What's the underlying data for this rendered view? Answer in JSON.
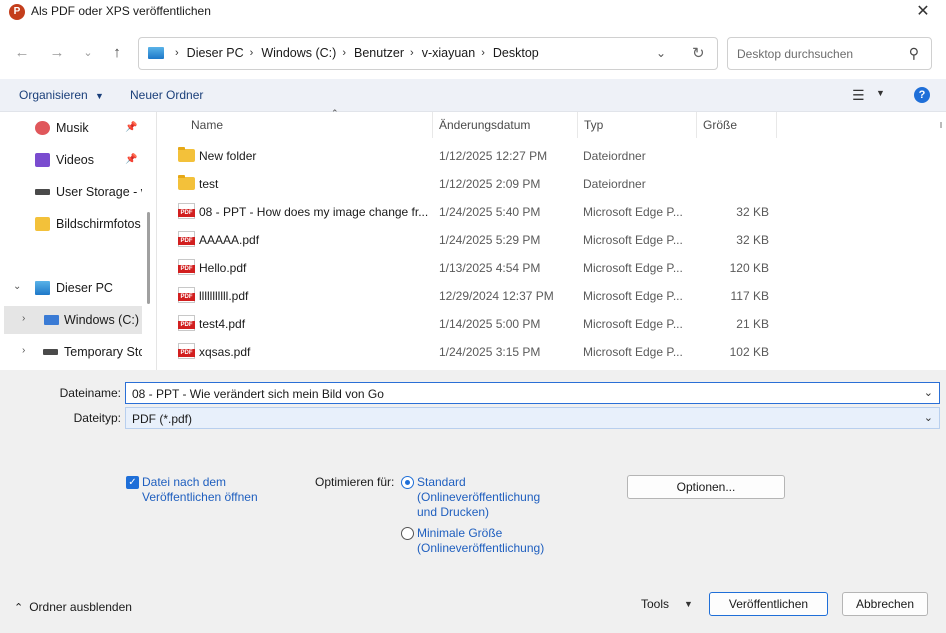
{
  "window": {
    "title": "Als PDF oder XPS veröffentlichen",
    "app_icon_letter": "P"
  },
  "address": {
    "crumbs": [
      "Dieser PC",
      "Windows (C:)",
      "Benutzer",
      "v-xiayuan",
      "Desktop"
    ],
    "search_placeholder": "Desktop durchsuchen"
  },
  "toolbar": {
    "organize": "Organisieren",
    "new_folder": "Neuer Ordner"
  },
  "nav": {
    "items": [
      {
        "label": "Musik",
        "icon": "music-icon",
        "pinned": true
      },
      {
        "label": "Videos",
        "icon": "video-icon",
        "pinned": true
      },
      {
        "label": "User Storage - v",
        "icon": "drive-icon",
        "pinned": false
      },
      {
        "label": "Bildschirmfotos",
        "icon": "folder-icon",
        "pinned": false
      },
      {
        "label": "Dieser PC",
        "icon": "pc-icon",
        "pinned": false
      },
      {
        "label": "Windows (C:)",
        "icon": "windows-drive-icon",
        "pinned": false
      },
      {
        "label": "Temporary Sto",
        "icon": "drive-icon",
        "pinned": false
      }
    ]
  },
  "files": {
    "columns": [
      "Name",
      "Änderungsdatum",
      "Typ",
      "Größe"
    ],
    "rows": [
      {
        "name": "New folder",
        "date": "1/12/2025 12:27 PM",
        "type": "Dateiordner",
        "size": "",
        "kind": "folder"
      },
      {
        "name": "test",
        "date": "1/12/2025 2:09 PM",
        "type": "Dateiordner",
        "size": "",
        "kind": "folder"
      },
      {
        "name": "08 - PPT - How does my image change fr...",
        "date": "1/24/2025 5:40 PM",
        "type": "Microsoft Edge P...",
        "size": "32 KB",
        "kind": "pdf"
      },
      {
        "name": "AAAAA.pdf",
        "date": "1/24/2025 5:29 PM",
        "type": "Microsoft Edge P...",
        "size": "32 KB",
        "kind": "pdf"
      },
      {
        "name": "Hello.pdf",
        "date": "1/13/2025 4:54 PM",
        "type": "Microsoft Edge P...",
        "size": "120 KB",
        "kind": "pdf"
      },
      {
        "name": "lllllllllll.pdf",
        "date": "12/29/2024 12:37 PM",
        "type": "Microsoft Edge P...",
        "size": "117 KB",
        "kind": "pdf"
      },
      {
        "name": "test4.pdf",
        "date": "1/14/2025 5:00 PM",
        "type": "Microsoft Edge P...",
        "size": "21 KB",
        "kind": "pdf"
      },
      {
        "name": "xqsas.pdf",
        "date": "1/24/2025 3:15 PM",
        "type": "Microsoft Edge P...",
        "size": "102 KB",
        "kind": "pdf"
      }
    ]
  },
  "form": {
    "filename_label": "Dateiname:",
    "filename_value": "08 - PPT - Wie verändert sich mein Bild von Go",
    "filetype_label": "Dateityp:",
    "filetype_value": "PDF (*.pdf)",
    "open_after_label": "Datei nach dem Veröffentlichen öffnen",
    "open_after_checked": true,
    "optimize_label": "Optimieren für:",
    "opt_standard": "Standard (Onlineveröffentlichung und Drucken)",
    "opt_minimal": "Minimale Größe (Onlineveröffentlichung)",
    "options_button": "Optionen...",
    "hide_folders": "Ordner ausblenden",
    "tools": "Tools",
    "publish_button": "Veröffentlichen",
    "cancel_button": "Abbrechen"
  },
  "colors": {
    "accent": "#1f6fd8",
    "cmdbar": "#eef1f7",
    "panel": "#f0f0f0"
  }
}
